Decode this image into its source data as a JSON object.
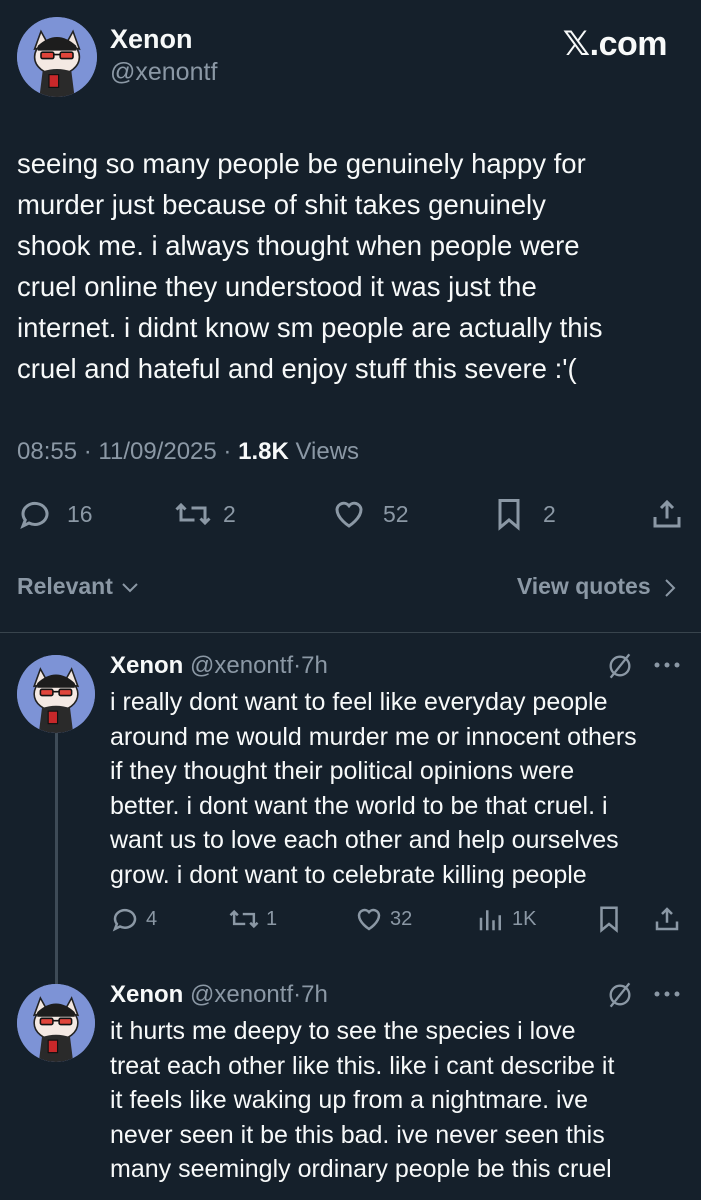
{
  "main_tweet": {
    "display_name": "Xenon",
    "handle": "@xenontf",
    "brand": "𝕏.com",
    "text": "seeing so many people be genuinely happy for\nmurder just because of shit takes genuinely\nshook me. i always thought when people were\ncruel online they understood it was just the\ninternet. i didnt know sm people are actually this\ncruel and hateful and enjoy stuff this severe :'(",
    "time": "08:55",
    "date": "11/09/2025",
    "views_count": "1.8K",
    "views_label": "Views",
    "separator": "·",
    "replies": "16",
    "reposts": "2",
    "likes": "52",
    "bookmarks": "2"
  },
  "sort": {
    "label": "Relevant",
    "view_quotes": "View quotes"
  },
  "replies": [
    {
      "display_name": "Xenon",
      "handle": "@xenontf",
      "age": "7h",
      "text": "i really dont want to feel like everyday people\naround me would murder me or innocent others\nif they thought their political opinions were\nbetter. i dont want the world to be that cruel. i\nwant us to love each other and help ourselves\ngrow. i dont want to celebrate killing people",
      "replies": "4",
      "reposts": "1",
      "likes": "32",
      "views": "1K"
    },
    {
      "display_name": "Xenon",
      "handle": "@xenontf",
      "age": "7h",
      "text": "it hurts me deepy to see the species i love\ntreat each other like this. like i cant describe it\nit feels like waking up from a nightmare. ive\nnever seen it be this bad. ive never seen this\nmany seemingly ordinary people be this cruel"
    }
  ],
  "icons": [
    "reply-icon",
    "repost-icon",
    "like-icon",
    "bookmark-icon",
    "share-icon",
    "views-icon",
    "grok-icon",
    "more-icon",
    "chevron-down-icon",
    "chevron-right-icon"
  ],
  "colors": {
    "background": "#15202b",
    "text": "#f7f9f9",
    "muted": "#8b98a5",
    "divider": "#38444d",
    "avatar_bg": "#7d93d6"
  }
}
